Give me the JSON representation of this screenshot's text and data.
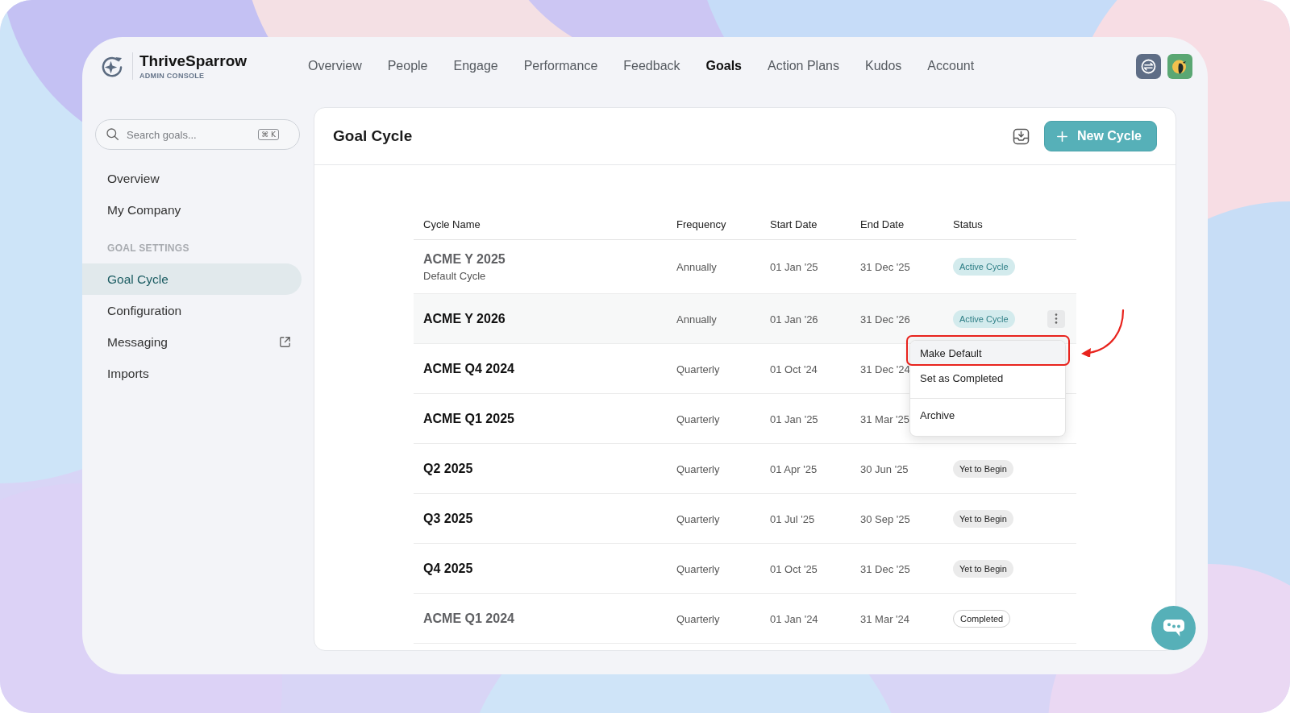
{
  "header": {
    "brand": {
      "name": "ThriveSparrow",
      "subtitle": "ADMIN CONSOLE"
    },
    "nav": [
      {
        "label": "Overview",
        "selected": false
      },
      {
        "label": "People",
        "selected": false
      },
      {
        "label": "Engage",
        "selected": false
      },
      {
        "label": "Performance",
        "selected": false
      },
      {
        "label": "Feedback",
        "selected": false
      },
      {
        "label": "Goals",
        "selected": true
      },
      {
        "label": "Action Plans",
        "selected": false
      },
      {
        "label": "Kudos",
        "selected": false
      },
      {
        "label": "Account",
        "selected": false
      }
    ]
  },
  "sidebar": {
    "search": {
      "placeholder": "Search goals...",
      "shortcut": "⌘ K"
    },
    "items": [
      {
        "label": "Overview",
        "selected": false,
        "external": false
      },
      {
        "label": "My Company",
        "selected": false,
        "external": false
      }
    ],
    "sections": [
      {
        "heading": "GOAL SETTINGS",
        "items": [
          {
            "label": "Goal Cycle",
            "selected": true,
            "external": false
          },
          {
            "label": "Configuration",
            "selected": false,
            "external": false
          },
          {
            "label": "Messaging",
            "selected": false,
            "external": true
          },
          {
            "label": "Imports",
            "selected": false,
            "external": false
          }
        ]
      }
    ]
  },
  "main": {
    "title": "Goal Cycle",
    "new_button": "New Cycle",
    "table": {
      "columns": [
        "Cycle Name",
        "Frequency",
        "Start Date",
        "End Date",
        "Status"
      ],
      "rows": [
        {
          "name": "ACME Y 2025",
          "subtitle": "Default Cycle",
          "muted": true,
          "hovered": false,
          "frequency": "Annually",
          "start": "01 Jan '25",
          "end": "31 Dec '25",
          "status": {
            "label": "Active Cycle",
            "kind": "active"
          }
        },
        {
          "name": "ACME Y 2026",
          "muted": false,
          "hovered": true,
          "frequency": "Annually",
          "start": "01 Jan '26",
          "end": "31 Dec '26",
          "status": {
            "label": "Active Cycle",
            "kind": "active"
          },
          "menu": {
            "items": [
              {
                "label": "Make Default",
                "highlighted": true,
                "annotated": true,
                "separated": false
              },
              {
                "label": "Set as Completed",
                "highlighted": false,
                "annotated": false,
                "separated": false
              },
              {
                "label": "Archive",
                "highlighted": false,
                "annotated": false,
                "separated": true
              }
            ]
          }
        },
        {
          "name": "ACME Q4 2024",
          "muted": false,
          "hovered": false,
          "frequency": "Quarterly",
          "start": "01 Oct '24",
          "end": "31 Dec '24"
        },
        {
          "name": "ACME Q1 2025",
          "muted": false,
          "hovered": false,
          "frequency": "Quarterly",
          "start": "01 Jan '25",
          "end": "31 Mar '25"
        },
        {
          "name": "Q2 2025",
          "muted": false,
          "hovered": false,
          "frequency": "Quarterly",
          "start": "01 Apr '25",
          "end": "30 Jun '25",
          "status": {
            "label": "Yet to Begin",
            "kind": "upcoming"
          }
        },
        {
          "name": "Q3 2025",
          "muted": false,
          "hovered": false,
          "frequency": "Quarterly",
          "start": "01 Jul '25",
          "end": "30 Sep '25",
          "status": {
            "label": "Yet to Begin",
            "kind": "upcoming"
          }
        },
        {
          "name": "Q4 2025",
          "muted": false,
          "hovered": false,
          "frequency": "Quarterly",
          "start": "01 Oct '25",
          "end": "31 Dec '25",
          "status": {
            "label": "Yet to Begin",
            "kind": "upcoming"
          }
        },
        {
          "name": "ACME Q1 2024",
          "muted": true,
          "hovered": false,
          "frequency": "Quarterly",
          "start": "01 Jan '24",
          "end": "31 Mar '24",
          "status": {
            "label": "Completed",
            "kind": "completed"
          }
        }
      ]
    }
  }
}
